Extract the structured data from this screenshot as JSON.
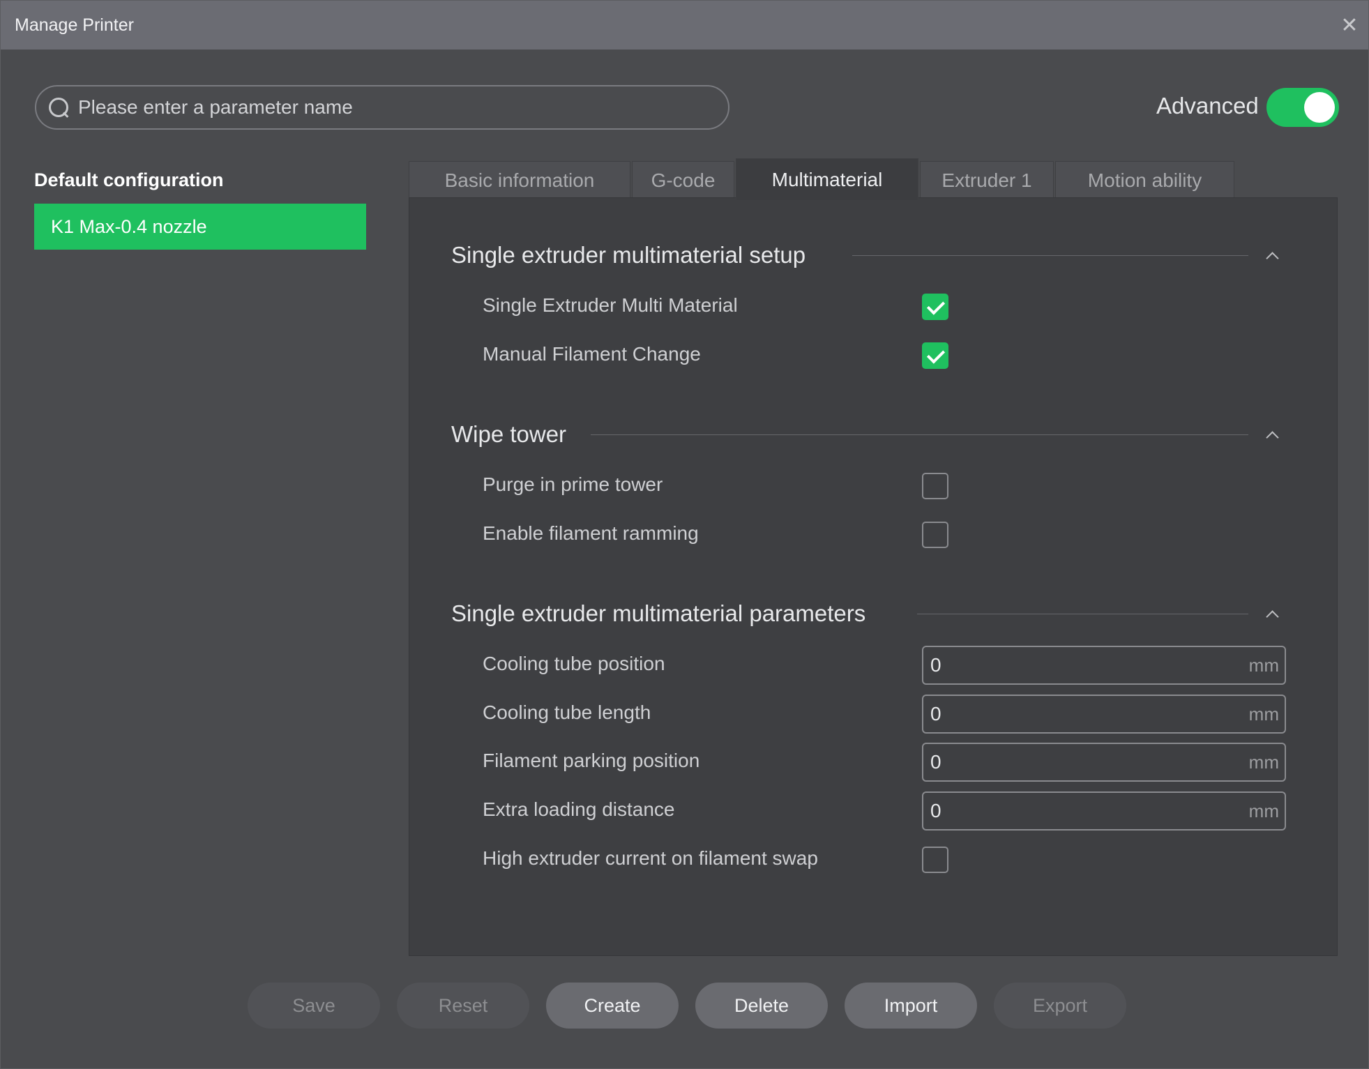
{
  "window": {
    "title": "Manage Printer"
  },
  "search": {
    "placeholder": "Please enter a parameter name"
  },
  "advanced": {
    "label": "Advanced",
    "enabled": true
  },
  "sidebar": {
    "title": "Default configuration",
    "presets": [
      {
        "label": "K1 Max-0.4 nozzle",
        "selected": true
      }
    ]
  },
  "tabs": [
    {
      "label": "Basic information",
      "active": false
    },
    {
      "label": "G-code",
      "active": false
    },
    {
      "label": "Multimaterial",
      "active": true
    },
    {
      "label": "Extruder 1",
      "active": false
    },
    {
      "label": "Motion ability",
      "active": false
    }
  ],
  "sections": [
    {
      "title": "Single extruder multimaterial setup",
      "rows": [
        {
          "label": "Single Extruder Multi Material",
          "type": "checkbox",
          "checked": true
        },
        {
          "label": "Manual Filament Change",
          "type": "checkbox",
          "checked": true
        }
      ]
    },
    {
      "title": "Wipe tower",
      "rows": [
        {
          "label": "Purge in prime tower",
          "type": "checkbox",
          "checked": false
        },
        {
          "label": "Enable filament ramming",
          "type": "checkbox",
          "checked": false
        }
      ]
    },
    {
      "title": "Single extruder multimaterial parameters",
      "rows": [
        {
          "label": "Cooling tube position",
          "type": "number",
          "value": "0",
          "unit": "mm"
        },
        {
          "label": "Cooling tube length",
          "type": "number",
          "value": "0",
          "unit": "mm"
        },
        {
          "label": "Filament parking position",
          "type": "number",
          "value": "0",
          "unit": "mm"
        },
        {
          "label": "Extra loading distance",
          "type": "number",
          "value": "0",
          "unit": "mm"
        },
        {
          "label": "High extruder current on filament swap",
          "type": "checkbox",
          "checked": false
        }
      ]
    }
  ],
  "buttons": [
    {
      "label": "Save",
      "enabled": false
    },
    {
      "label": "Reset",
      "enabled": false
    },
    {
      "label": "Create",
      "enabled": true
    },
    {
      "label": "Delete",
      "enabled": true
    },
    {
      "label": "Import",
      "enabled": true
    },
    {
      "label": "Export",
      "enabled": false
    }
  ],
  "colors": {
    "accent": "#1fc05f",
    "window_bg": "#4a4b4e",
    "panel_bg": "#3e3f42",
    "titlebar": "#6b6c73"
  }
}
